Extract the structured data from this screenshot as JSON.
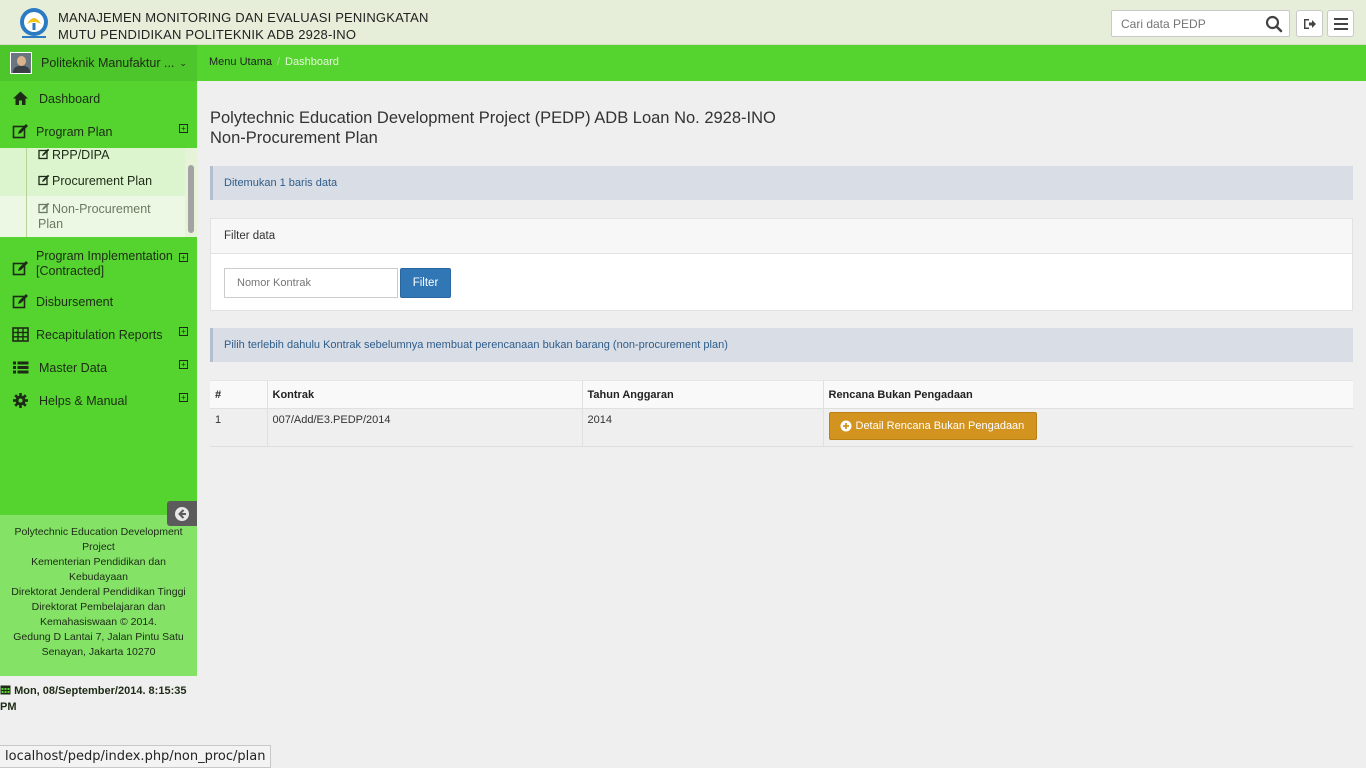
{
  "header": {
    "title_line1": "MANAJEMEN MONITORING DAN EVALUASI PENINGKATAN",
    "title_line2": "MUTU PENDIDIKAN POLITEKNIK ADB 2928-INO",
    "search_placeholder": "Cari data PEDP",
    "logo_icon": "tut-wuri-handayani-logo",
    "search_icon": "search-icon",
    "logout_icon": "sign-out-icon",
    "menu_icon": "hamburger-menu-icon"
  },
  "navbar": {
    "user_name": "Politeknik Manufaktur ...",
    "caret": "⌄",
    "breadcrumb": [
      "Menu Utama",
      "/",
      "Dashboard"
    ]
  },
  "sidebar": {
    "items": [
      {
        "label": "Dashboard",
        "icon": "home-icon"
      },
      {
        "label": "Program Plan",
        "icon": "edit-icon",
        "expandable": true
      },
      {
        "label": "Program Implementation [Contracted]",
        "icon": "edit-icon",
        "expandable": true
      },
      {
        "label": "Disbursement",
        "icon": "edit-icon"
      },
      {
        "label": "Recapitulation Reports",
        "icon": "table-icon",
        "expandable": true
      },
      {
        "label": "Master Data",
        "icon": "list-icon",
        "expandable": true
      },
      {
        "label": "Helps & Manual",
        "icon": "gear-icon",
        "expandable": true
      }
    ],
    "submenu": [
      "RPP/DIPA",
      "Procurement Plan",
      "Non-Procurement Plan"
    ],
    "plus": "+",
    "footer_lines": [
      "Polytechnic Education Development Project",
      "Kementerian Pendidikan dan Kebudayaan",
      "Direktorat Jenderal Pendidikan Tinggi",
      "Direktorat Pembelajaran dan Kemahasiswaan © 2014.",
      "Gedung D Lantai 7, Jalan Pintu Satu Senayan, Jakarta 10270"
    ],
    "datetime": "Mon, 08/September/2014. 8:15:35 PM"
  },
  "main": {
    "title_line1": "Polytechnic Education Development Project (PEDP) ADB Loan No. 2928-INO",
    "title_line2": "Non-Procurement Plan",
    "found_text": "Ditemukan 1 baris data",
    "filter": {
      "heading": "Filter data",
      "input_placeholder": "Nomor Kontrak",
      "button_label": "Filter"
    },
    "notice": "Pilih terlebih dahulu Kontrak sebelumnya membuat perencanaan bukan barang (non-procurement plan)",
    "table": {
      "headers": [
        "#",
        "Kontrak",
        "Tahun Anggaran",
        "Rencana Bukan Pengadaan"
      ],
      "rows": [
        {
          "no": "1",
          "kontrak": "007/Add/E3.PEDP/2014",
          "tahun": "2014",
          "action": "Detail Rencana Bukan Pengadaan"
        }
      ]
    }
  },
  "status_bar": {
    "url": "localhost/pedp/index.php/non_proc/plan"
  },
  "colors": {
    "header_bg": "#e6edd9",
    "nav_green": "#55d42f",
    "info_bar": "#d8dde6",
    "primary_button": "#3176b5",
    "warning_button": "#d3931f"
  }
}
